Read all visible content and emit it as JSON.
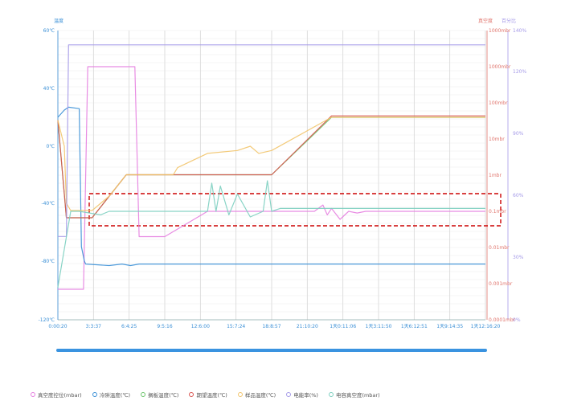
{
  "chart_data": {
    "type": "line",
    "axes": {
      "temperature": {
        "title": "温度",
        "ticks": [
          "60℃",
          "40℃",
          "0℃",
          "-40℃",
          "-80℃",
          "-120℃"
        ],
        "range": [
          -120,
          60
        ]
      },
      "vacuum": {
        "title": "真空度",
        "ticks": [
          "1000mbr",
          "1000mbr",
          "100mbr",
          "10mbr",
          "1mbr",
          "0.1mbr",
          "0.01mbr",
          "0.001mbr",
          "0.0001mbr"
        ],
        "scale": "log"
      },
      "percent": {
        "title": "百分比",
        "ticks": [
          "140%",
          "120%",
          "90%",
          "60%",
          "30%",
          "0%"
        ],
        "range": [
          0,
          140
        ]
      },
      "x_ticks": [
        "0:00:20",
        "3:3:37",
        "6:4:25",
        "9:5:16",
        "12:6:00",
        "15:7:24",
        "18:8:57",
        "21:10:20",
        "1天0:11:06",
        "1天3:11:50",
        "1天6:12:51",
        "1天9:14:35",
        "1天12:16:20"
      ]
    },
    "series": [
      {
        "name": "真空度控位(mbar)",
        "color": "#e57fe0",
        "axis": "vacuum",
        "points": [
          [
            0,
            0.0007
          ],
          [
            6,
            0.0007
          ],
          [
            7,
            1000
          ],
          [
            18,
            1000
          ],
          [
            19,
            0.02
          ],
          [
            25,
            0.02
          ],
          [
            35,
            0.1
          ],
          [
            60,
            0.1
          ],
          [
            62,
            0.15
          ],
          [
            63,
            0.08
          ],
          [
            64,
            0.12
          ],
          [
            66,
            0.06
          ],
          [
            68,
            0.1
          ],
          [
            70,
            0.09
          ],
          [
            72,
            0.1
          ],
          [
            100,
            0.1
          ]
        ]
      },
      {
        "name": "冷阱温度(℃)",
        "color": "#3a8fd6",
        "axis": "temperature",
        "points": [
          [
            0,
            20
          ],
          [
            1.5,
            25
          ],
          [
            2.5,
            27
          ],
          [
            5,
            26
          ],
          [
            5.5,
            -70
          ],
          [
            6.2,
            -80
          ],
          [
            6.5,
            -82
          ],
          [
            12,
            -83
          ],
          [
            15,
            -82
          ],
          [
            17,
            -83
          ],
          [
            19,
            -82
          ],
          [
            40,
            -82
          ],
          [
            60,
            -82
          ],
          [
            100,
            -82
          ]
        ]
      },
      {
        "name": "搁板温度(℃)",
        "color": "#6cc56c",
        "axis": "temperature",
        "points": [
          [
            0,
            18
          ],
          [
            2,
            -50
          ],
          [
            8,
            -50
          ],
          [
            16,
            -20
          ],
          [
            50,
            -20
          ],
          [
            64,
            20
          ],
          [
            100,
            20
          ]
        ]
      },
      {
        "name": "期望温度(℃)",
        "color": "#d9534f",
        "axis": "temperature",
        "points": [
          [
            0,
            18
          ],
          [
            2,
            -50
          ],
          [
            8,
            -50
          ],
          [
            16,
            -20
          ],
          [
            50,
            -20
          ],
          [
            64,
            21
          ],
          [
            100,
            21
          ]
        ]
      },
      {
        "name": "样品温度(℃)",
        "color": "#f2c46a",
        "axis": "temperature",
        "points": [
          [
            0,
            18
          ],
          [
            1.5,
            0
          ],
          [
            2,
            -40
          ],
          [
            3,
            -45
          ],
          [
            8,
            -45
          ],
          [
            12,
            -35
          ],
          [
            16,
            -20
          ],
          [
            27,
            -20
          ],
          [
            28,
            -15
          ],
          [
            35,
            -5
          ],
          [
            42,
            -3
          ],
          [
            45,
            0
          ],
          [
            47,
            -5
          ],
          [
            50,
            -3
          ],
          [
            64,
            20
          ],
          [
            100,
            20
          ]
        ]
      },
      {
        "name": "电能率(%)",
        "color": "#a59ae8",
        "axis": "percent",
        "points": [
          [
            0,
            40
          ],
          [
            2,
            40
          ],
          [
            2.5,
            133
          ],
          [
            100,
            133
          ]
        ]
      },
      {
        "name": "电容真空度(mbar)",
        "color": "#7ccfc0",
        "axis": "vacuum",
        "points": [
          [
            0,
            0.0008
          ],
          [
            3,
            0.1
          ],
          [
            5,
            0.1
          ],
          [
            10,
            0.08
          ],
          [
            12,
            0.1
          ],
          [
            30,
            0.1
          ],
          [
            35,
            0.1
          ],
          [
            36,
            0.6
          ],
          [
            37,
            0.1
          ],
          [
            38,
            0.5
          ],
          [
            40,
            0.08
          ],
          [
            42,
            0.3
          ],
          [
            45,
            0.07
          ],
          [
            48,
            0.1
          ],
          [
            49,
            0.7
          ],
          [
            50,
            0.1
          ],
          [
            52,
            0.12
          ],
          [
            100,
            0.12
          ]
        ]
      }
    ],
    "grid": true,
    "legend": "bottom"
  }
}
